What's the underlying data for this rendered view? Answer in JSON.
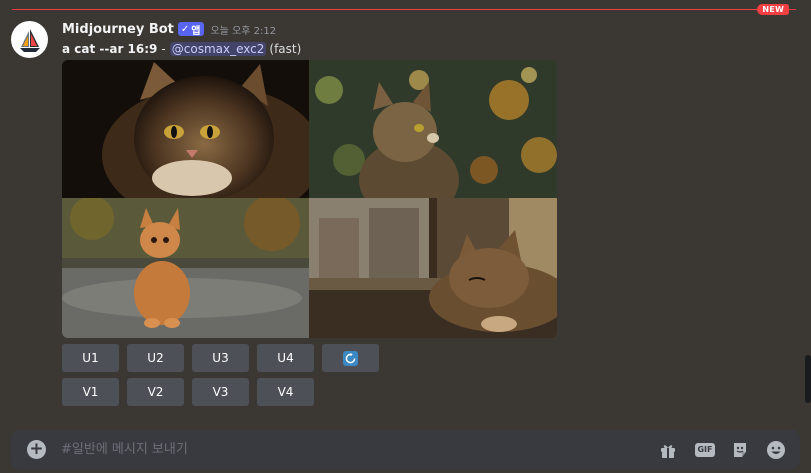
{
  "divider": {
    "badge": "NEW",
    "color": "#f23f42"
  },
  "message": {
    "author": "Midjourney Bot",
    "app_badge": "앱",
    "timestamp": "오늘 오후 2:12",
    "prompt": "a cat --ar 16:9",
    "separator": "-",
    "mention": "@cosmax_exc2",
    "speed": "(fast)"
  },
  "images": [
    {
      "name": "close-up tabby cat on dark background"
    },
    {
      "name": "tabby cat with bokeh autumn leaves"
    },
    {
      "name": "orange cat sitting on path"
    },
    {
      "name": "cat lying by window"
    }
  ],
  "buttons": {
    "row1": [
      "U1",
      "U2",
      "U3",
      "U4"
    ],
    "row2": [
      "V1",
      "V2",
      "V3",
      "V4"
    ],
    "reroll_icon": "refresh-icon"
  },
  "composer": {
    "placeholder": "#일반에 메시지 보내기",
    "icons": [
      "plus-icon",
      "gift-icon",
      "gif-icon",
      "sticker-icon",
      "emoji-icon"
    ],
    "gif_label": "GIF"
  },
  "colors": {
    "accent": "#5865f2",
    "background": "#3b3732",
    "button": "#4e5058"
  }
}
